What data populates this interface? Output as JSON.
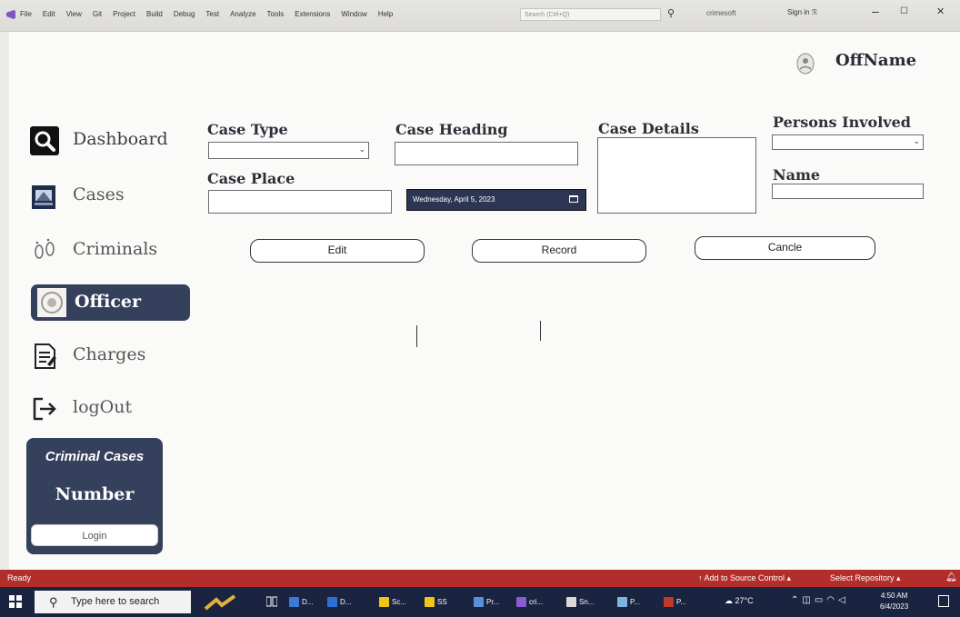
{
  "vs": {
    "menu": [
      "File",
      "Edit",
      "View",
      "Git",
      "Project",
      "Build",
      "Debug",
      "Test",
      "Analyze",
      "Tools",
      "Extensions",
      "Window",
      "Help"
    ],
    "search_placeholder": "Search (Ctrl+Q)",
    "solution_name": "crimesoft",
    "sign_in": "Sign in",
    "status_ready": "Ready",
    "add_source_control": "↑ Add to Source Control ▴",
    "select_repository": "Select Repository ▴"
  },
  "header": {
    "officer_name": "OffName"
  },
  "sidebar": {
    "items": [
      {
        "label": "Dashboard",
        "icon": "search-icon"
      },
      {
        "label": "Cases",
        "icon": "cases-icon"
      },
      {
        "label": "Criminals",
        "icon": "footprints-icon"
      },
      {
        "label": "Officer",
        "icon": "officer-badge-icon",
        "active": true
      },
      {
        "label": "Charges",
        "icon": "document-icon"
      },
      {
        "label": "logOut",
        "icon": "logout-icon"
      }
    ],
    "card": {
      "title": "Criminal Cases",
      "value": "Number",
      "button": "Login"
    }
  },
  "form": {
    "case_type_label": "Case Type",
    "case_heading_label": "Case Heading",
    "case_details_label": "Case Details",
    "persons_involved_label": "Persons Involved",
    "case_place_label": "Case Place",
    "name_label": "Name",
    "date_value": "Wednesday, April 5, 2023",
    "buttons": {
      "edit": "Edit",
      "record": "Record",
      "cancel": "Cancle"
    }
  },
  "taskbar": {
    "search_placeholder": "Type here to search",
    "apps": [
      "D...",
      "D...",
      "Sc...",
      "SS",
      "Pr...",
      "cri...",
      "Sn...",
      "P...",
      "P..."
    ],
    "weather": "27°C",
    "time": "4:50 AM",
    "date": "6/4/2023"
  },
  "colors": {
    "accent": "#34405c",
    "status_bar": "#b32d2b",
    "taskbar": "#1a2440"
  }
}
